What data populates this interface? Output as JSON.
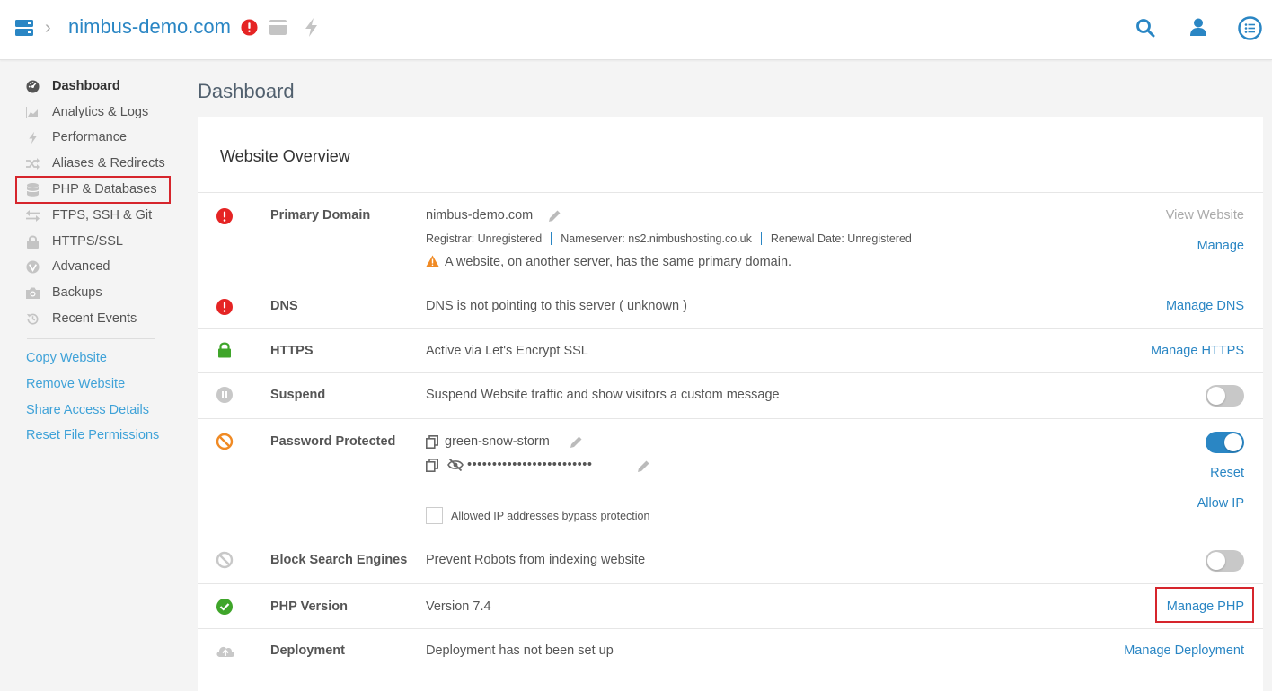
{
  "header": {
    "site_title": "nimbus-demo.com",
    "icons": [
      "server-icon",
      "alert-icon",
      "card-icon",
      "bolt-icon",
      "search-icon",
      "user-icon",
      "menu-icon"
    ]
  },
  "sidebar": {
    "items": [
      {
        "label": "Dashboard",
        "icon": "dashboard-icon",
        "active": true
      },
      {
        "label": "Analytics & Logs",
        "icon": "chart-icon"
      },
      {
        "label": "Performance",
        "icon": "bolt-icon"
      },
      {
        "label": "Aliases & Redirects",
        "icon": "shuffle-icon"
      },
      {
        "label": "PHP & Databases",
        "icon": "database-icon"
      },
      {
        "label": "FTPS, SSH & Git",
        "icon": "transfer-icon"
      },
      {
        "label": "HTTPS/SSL",
        "icon": "lock-icon"
      },
      {
        "label": "Advanced",
        "icon": "advanced-icon"
      },
      {
        "label": "Backups",
        "icon": "camera-icon"
      },
      {
        "label": "Recent Events",
        "icon": "history-icon"
      }
    ],
    "links": [
      "Copy Website",
      "Remove Website",
      "Share Access Details",
      "Reset File Permissions"
    ]
  },
  "main": {
    "page_title": "Dashboard",
    "card_title": "Website Overview",
    "primary_domain": {
      "label": "Primary Domain",
      "value": "nimbus-demo.com",
      "registrar": "Registrar: Unregistered",
      "nameserver": "Nameserver: ns2.nimbushosting.co.uk",
      "renewal": "Renewal Date: Unregistered",
      "warning": "A website, on another server, has the same primary domain.",
      "action_view": "View Website",
      "action_manage": "Manage"
    },
    "dns": {
      "label": "DNS",
      "text": "DNS is not pointing to this server ( unknown )",
      "action": "Manage DNS"
    },
    "https": {
      "label": "HTTPS",
      "text": "Active via Let's Encrypt SSL",
      "action": "Manage HTTPS"
    },
    "suspend": {
      "label": "Suspend",
      "text": "Suspend Website traffic and show visitors a custom message",
      "enabled": false
    },
    "password": {
      "label": "Password Protected",
      "username": "green-snow-storm",
      "password_masked": "•••••••••••••••••••••••••",
      "bypass_label": "Allowed IP addresses bypass protection",
      "enabled": true,
      "action_reset": "Reset",
      "action_allow": "Allow IP"
    },
    "block_search": {
      "label": "Block Search Engines",
      "text": "Prevent Robots from indexing website",
      "enabled": false
    },
    "php": {
      "label": "PHP Version",
      "text": "Version 7.4",
      "action": "Manage PHP"
    },
    "deployment": {
      "label": "Deployment",
      "text": "Deployment has not been set up",
      "action": "Manage Deployment"
    }
  },
  "colors": {
    "accent": "#2a86c4",
    "link": "#3fa2d8",
    "error": "#e52424",
    "success": "#3fa52a",
    "warning": "#f08a24",
    "highlight": "#d6252c"
  }
}
